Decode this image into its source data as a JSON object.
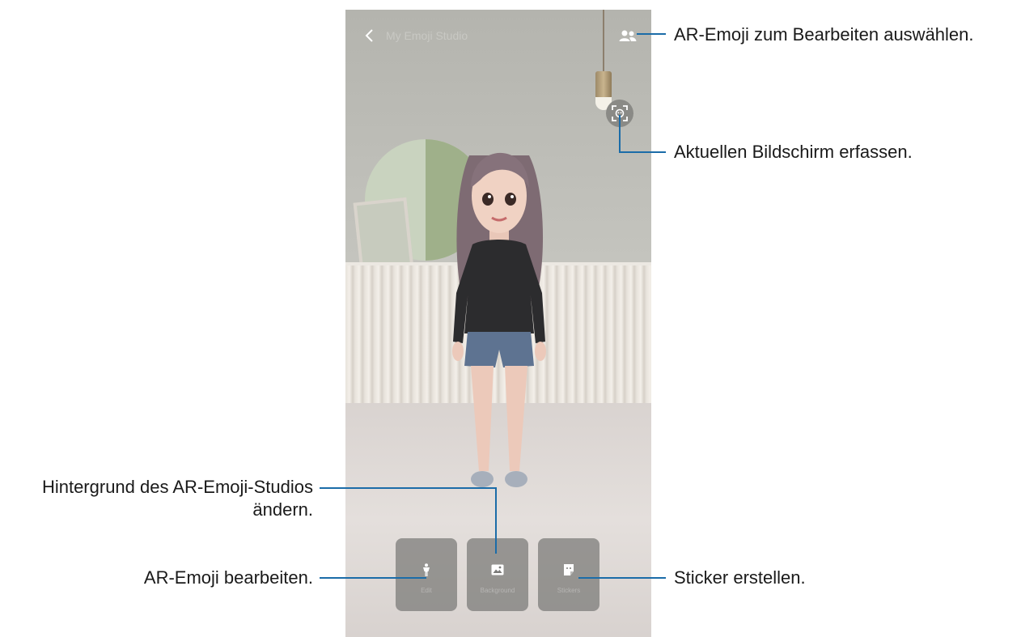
{
  "topbar": {
    "title": "My Emoji Studio"
  },
  "toolbar": {
    "items": [
      {
        "label": "Edit",
        "icon": "person-icon"
      },
      {
        "label": "Background",
        "icon": "image-icon"
      },
      {
        "label": "Stickers",
        "icon": "sticker-icon"
      }
    ]
  },
  "callouts": {
    "select_emoji": "AR-Emoji zum Bearbeiten auswählen.",
    "capture": "Aktuellen Bildschirm erfassen.",
    "background_line1": "Hintergrund des AR-Emoji-Studios",
    "background_line2": "ändern.",
    "edit": "AR-Emoji bearbeiten.",
    "stickers": "Sticker erstellen."
  },
  "colors": {
    "callout_line": "#1b6ca8"
  }
}
